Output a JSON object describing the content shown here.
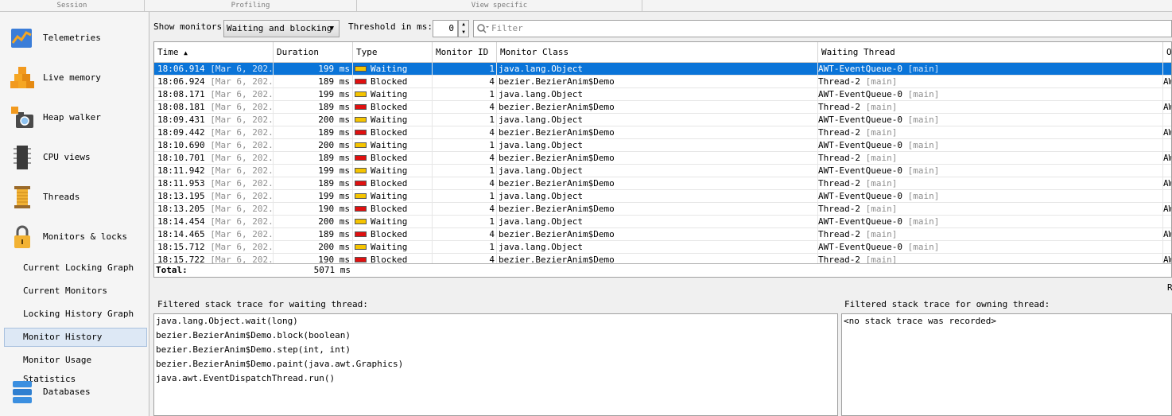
{
  "top_sections": [
    "Session",
    "Profiling",
    "View specific"
  ],
  "sidebar": {
    "items": [
      {
        "label": "Telemetries"
      },
      {
        "label": "Live memory"
      },
      {
        "label": "Heap walker"
      },
      {
        "label": "CPU views"
      },
      {
        "label": "Threads"
      },
      {
        "label": "Monitors & locks"
      }
    ],
    "sub_items": [
      {
        "label": "Current Locking Graph"
      },
      {
        "label": "Current Monitors"
      },
      {
        "label": "Locking History Graph"
      },
      {
        "label": "Monitor History"
      },
      {
        "label": "Monitor Usage Statistics"
      }
    ],
    "bottom_item": {
      "label": "Databases"
    }
  },
  "toolbar": {
    "show_monitors_label": "Show monitors:",
    "show_monitors_value": "Waiting and blocking",
    "threshold_label": "Threshold in ms:",
    "threshold_value": "0",
    "filter_placeholder": "Filter"
  },
  "table": {
    "columns": [
      "Time",
      "Duration",
      "Type",
      "Monitor ID",
      "Monitor Class",
      "Waiting Thread",
      "Ow"
    ],
    "sort_indicator": "▲",
    "rows": [
      {
        "time": "18:06.914",
        "date": "[Mar 6, 202...",
        "duration": "199 ms",
        "type": "Waiting",
        "id": "1",
        "class": "java.lang.Object",
        "thread": "AWT-EventQueue-0",
        "group": "[main]",
        "owner": ""
      },
      {
        "time": "18:06.924",
        "date": "[Mar 6, 202...",
        "duration": "189 ms",
        "type": "Blocked",
        "id": "4",
        "class": "bezier.BezierAnim$Demo",
        "thread": "Thread-2",
        "group": "[main]",
        "owner": "AW"
      },
      {
        "time": "18:08.171",
        "date": "[Mar 6, 202...",
        "duration": "199 ms",
        "type": "Waiting",
        "id": "1",
        "class": "java.lang.Object",
        "thread": "AWT-EventQueue-0",
        "group": "[main]",
        "owner": ""
      },
      {
        "time": "18:08.181",
        "date": "[Mar 6, 202...",
        "duration": "189 ms",
        "type": "Blocked",
        "id": "4",
        "class": "bezier.BezierAnim$Demo",
        "thread": "Thread-2",
        "group": "[main]",
        "owner": "AW"
      },
      {
        "time": "18:09.431",
        "date": "[Mar 6, 202...",
        "duration": "200 ms",
        "type": "Waiting",
        "id": "1",
        "class": "java.lang.Object",
        "thread": "AWT-EventQueue-0",
        "group": "[main]",
        "owner": ""
      },
      {
        "time": "18:09.442",
        "date": "[Mar 6, 202...",
        "duration": "189 ms",
        "type": "Blocked",
        "id": "4",
        "class": "bezier.BezierAnim$Demo",
        "thread": "Thread-2",
        "group": "[main]",
        "owner": "AW"
      },
      {
        "time": "18:10.690",
        "date": "[Mar 6, 202...",
        "duration": "200 ms",
        "type": "Waiting",
        "id": "1",
        "class": "java.lang.Object",
        "thread": "AWT-EventQueue-0",
        "group": "[main]",
        "owner": ""
      },
      {
        "time": "18:10.701",
        "date": "[Mar 6, 202...",
        "duration": "189 ms",
        "type": "Blocked",
        "id": "4",
        "class": "bezier.BezierAnim$Demo",
        "thread": "Thread-2",
        "group": "[main]",
        "owner": "AW"
      },
      {
        "time": "18:11.942",
        "date": "[Mar 6, 202...",
        "duration": "199 ms",
        "type": "Waiting",
        "id": "1",
        "class": "java.lang.Object",
        "thread": "AWT-EventQueue-0",
        "group": "[main]",
        "owner": ""
      },
      {
        "time": "18:11.953",
        "date": "[Mar 6, 202...",
        "duration": "189 ms",
        "type": "Blocked",
        "id": "4",
        "class": "bezier.BezierAnim$Demo",
        "thread": "Thread-2",
        "group": "[main]",
        "owner": "AW"
      },
      {
        "time": "18:13.195",
        "date": "[Mar 6, 202...",
        "duration": "199 ms",
        "type": "Waiting",
        "id": "1",
        "class": "java.lang.Object",
        "thread": "AWT-EventQueue-0",
        "group": "[main]",
        "owner": ""
      },
      {
        "time": "18:13.205",
        "date": "[Mar 6, 202...",
        "duration": "190 ms",
        "type": "Blocked",
        "id": "4",
        "class": "bezier.BezierAnim$Demo",
        "thread": "Thread-2",
        "group": "[main]",
        "owner": "AW"
      },
      {
        "time": "18:14.454",
        "date": "[Mar 6, 202...",
        "duration": "200 ms",
        "type": "Waiting",
        "id": "1",
        "class": "java.lang.Object",
        "thread": "AWT-EventQueue-0",
        "group": "[main]",
        "owner": ""
      },
      {
        "time": "18:14.465",
        "date": "[Mar 6, 202...",
        "duration": "189 ms",
        "type": "Blocked",
        "id": "4",
        "class": "bezier.BezierAnim$Demo",
        "thread": "Thread-2",
        "group": "[main]",
        "owner": "AW"
      },
      {
        "time": "18:15.712",
        "date": "[Mar 6, 202...",
        "duration": "200 ms",
        "type": "Waiting",
        "id": "1",
        "class": "java.lang.Object",
        "thread": "AWT-EventQueue-0",
        "group": "[main]",
        "owner": ""
      },
      {
        "time": "18:15.722",
        "date": "[Mar 6, 202...",
        "duration": "190 ms",
        "type": "Blocked",
        "id": "4",
        "class": "bezier.BezierAnim$Demo",
        "thread": "Thread-2",
        "group": "[main]",
        "owner": "AW"
      }
    ],
    "total_label": "Total:",
    "total_value": "5071 ms",
    "type_colors": {
      "Waiting": "#f5c400",
      "Blocked": "#e01010"
    }
  },
  "right_edge_letter": "R",
  "stack_waiting": {
    "title": "Filtered stack trace for waiting thread:",
    "lines": [
      "java.lang.Object.wait(long)",
      "bezier.BezierAnim$Demo.block(boolean)",
      "bezier.BezierAnim$Demo.step(int, int)",
      "bezier.BezierAnim$Demo.paint(java.awt.Graphics)",
      "java.awt.EventDispatchThread.run()"
    ]
  },
  "stack_owning": {
    "title": "Filtered stack trace for owning thread:",
    "lines": [
      "<no stack trace was recorded>"
    ]
  }
}
